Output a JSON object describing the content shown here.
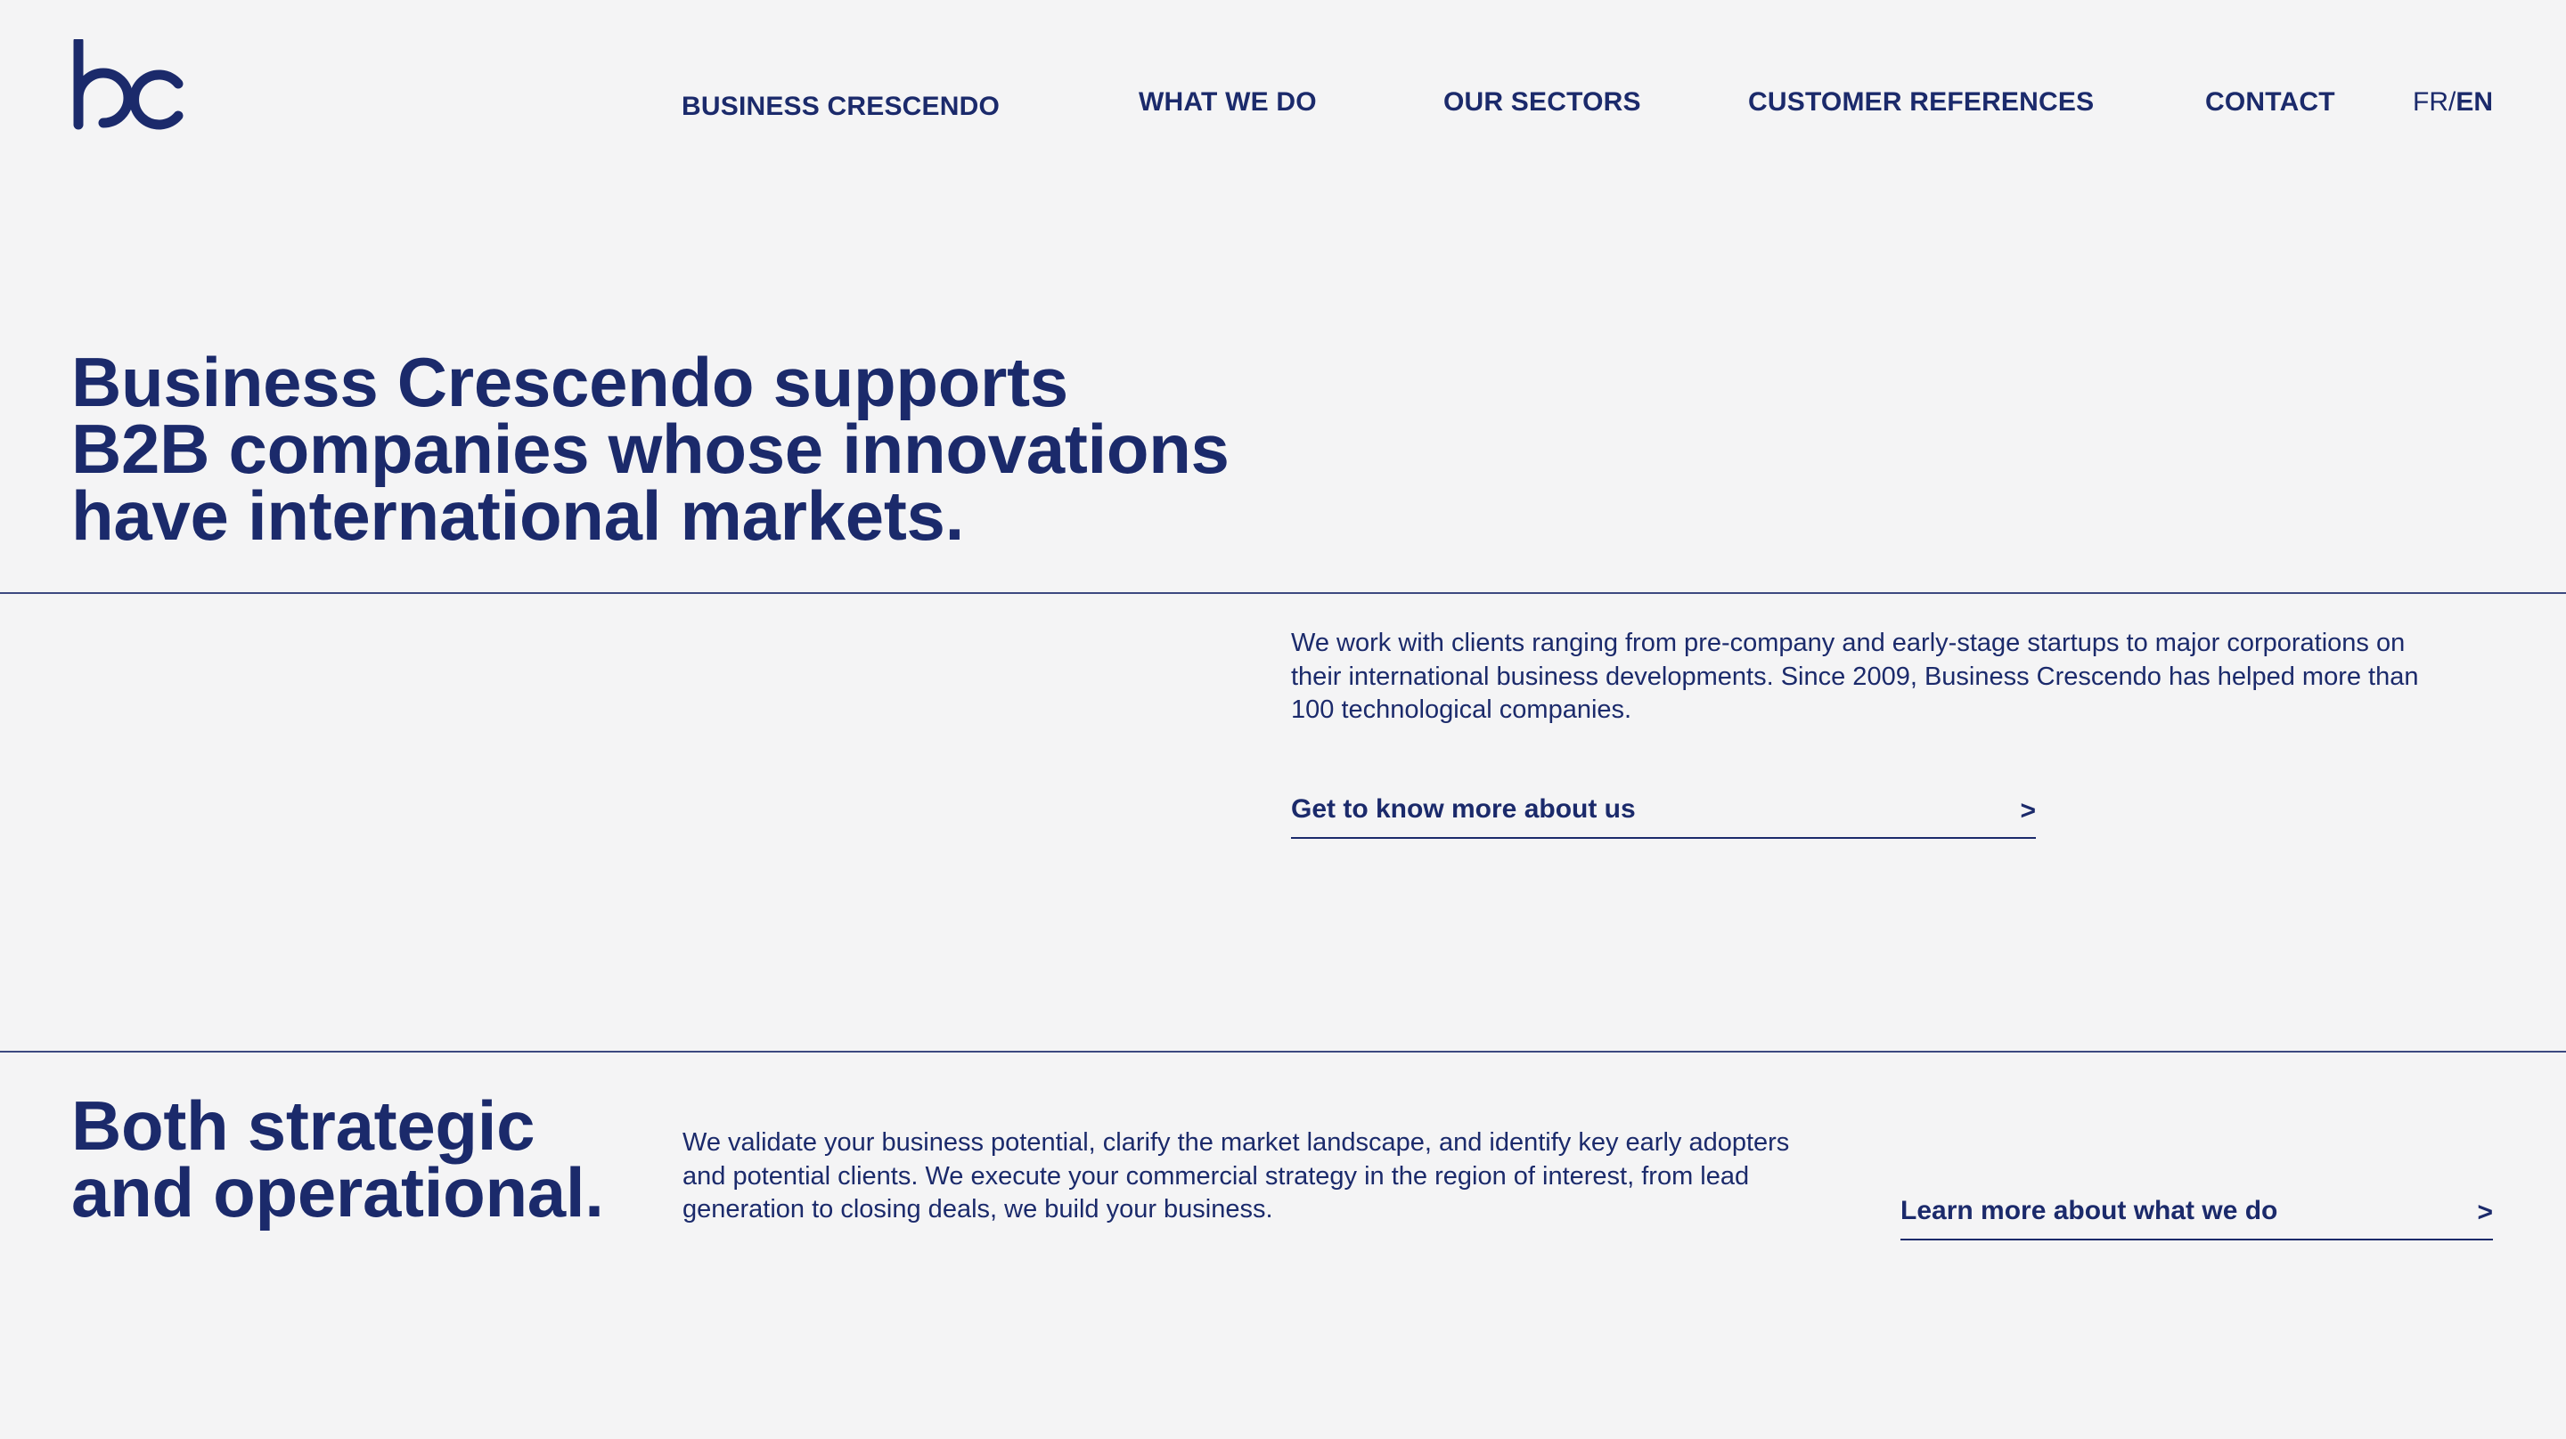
{
  "brand": {
    "logo_icon": "bc-logo-icon",
    "color": "#1b2a6b",
    "background": "#f4f4f5"
  },
  "nav": {
    "items": [
      {
        "label": "BUSINESS CRESCENDO"
      },
      {
        "label": "WHAT WE DO"
      },
      {
        "label": "OUR SECTORS"
      },
      {
        "label": "CUSTOMER REFERENCES"
      },
      {
        "label": "CONTACT"
      }
    ],
    "lang": {
      "fr": "FR",
      "separator": "/",
      "en": "EN"
    }
  },
  "hero": {
    "title_lines": [
      "Business Crescendo supports",
      "B2B companies whose innovations",
      "have international markets."
    ],
    "intro": "We work with clients ranging from pre-company and early-stage startups to major corporations on their international business developments. Since 2009, Business Crescendo has helped more than 100 technological companies.",
    "cta": {
      "label": "Get to know more about us",
      "arrow": ">"
    }
  },
  "section2": {
    "title_lines": [
      "Both strategic",
      "and operational."
    ],
    "text": "We validate your business potential, clarify the market landscape, and identify key early adopters and potential clients. We execute your commercial strategy in the region of interest, from lead generation to closing deals, we build your business.",
    "cta": {
      "label": "Learn more about what we do",
      "arrow": ">"
    }
  }
}
